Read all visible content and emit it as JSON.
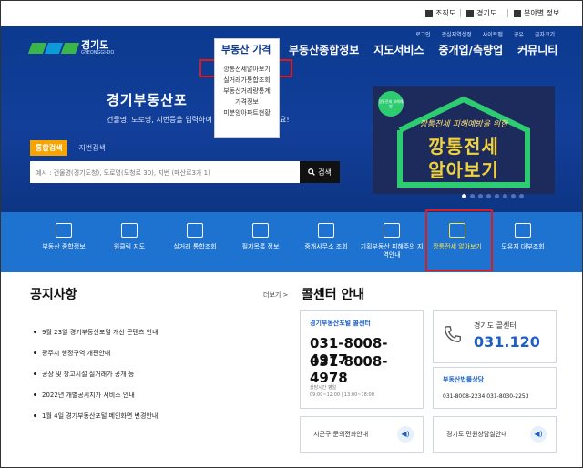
{
  "util": {
    "items": [
      "조직도",
      "경기도",
      "분야별 정보"
    ]
  },
  "header": {
    "logo_text": "경기도",
    "logo_sub": "GYEONGGI-DO",
    "subnav": [
      "로그인",
      "관심지역설정",
      "사이트맵",
      "공유",
      "글자크기"
    ],
    "mainnav": [
      "부동산종합정보",
      "지도서비스",
      "중개업/측량업",
      "커뮤니티"
    ]
  },
  "dropdown": {
    "title": "부동산 가격",
    "items": [
      "깡통전세알아보기",
      "실거래가통합조회",
      "부동산거래량통계",
      "가격정보",
      "미분양아파트현황"
    ]
  },
  "hero": {
    "title": "경기부동산포",
    "desc": "건물명, 도로명, 지번등을 입력하여 부동",
    "desc_end": "요!",
    "tab_active": "통합검색",
    "tab_other": "지번검색",
    "search_placeholder": "예시 : 건물명(경기도청), 도로명(도청로 30), 지번 (매산로3가 1)",
    "search_button": "검색"
  },
  "banner": {
    "badge": "깡통전세 피해예방",
    "subtitle": "깡통전세 피해예방을 위한",
    "line1": "깡통전세",
    "line2": "알아보기"
  },
  "quick": [
    {
      "label": "부동산 종합정보"
    },
    {
      "label": "원클릭 지도"
    },
    {
      "label": "실거래 통합조회"
    },
    {
      "label": "필지목록 정보"
    },
    {
      "label": "중개사무소 조회"
    },
    {
      "label": "기획부동산 피해주의 지역안내"
    },
    {
      "label": "깡통전세 알아보기"
    },
    {
      "label": "도유지 대부조회"
    }
  ],
  "notice": {
    "title": "공지사항",
    "more": "더보기 >",
    "items": [
      "9월 23일 경기부동산포털 개선 콘텐츠 안내",
      "광주시 행정구역 개편안내",
      "공장 및 창고시설 실거래가 공개 등",
      "2022년 개별공시지가 서비스 안내",
      "1월 4일 경기부동산포털 메인화면 변경안내"
    ]
  },
  "callcenter": {
    "title": "콜센터 안내",
    "portal_title": "경기부동산포털 콜센터",
    "portal_num1": "031-8008-4977",
    "portal_num2": "031-8008-4978",
    "hours_label": "상담시간 평일",
    "hours": "09:00~12:00 | 13:00~18:00",
    "gg_label": "경기도 콜센터",
    "gg_num": "031.120",
    "law_title": "부동산법률상담",
    "law_nums": "031-8008-2234    031-8030-2253",
    "sigungu": "시군구 문의전화안내",
    "civil": "경기도 민원상담실안내"
  }
}
